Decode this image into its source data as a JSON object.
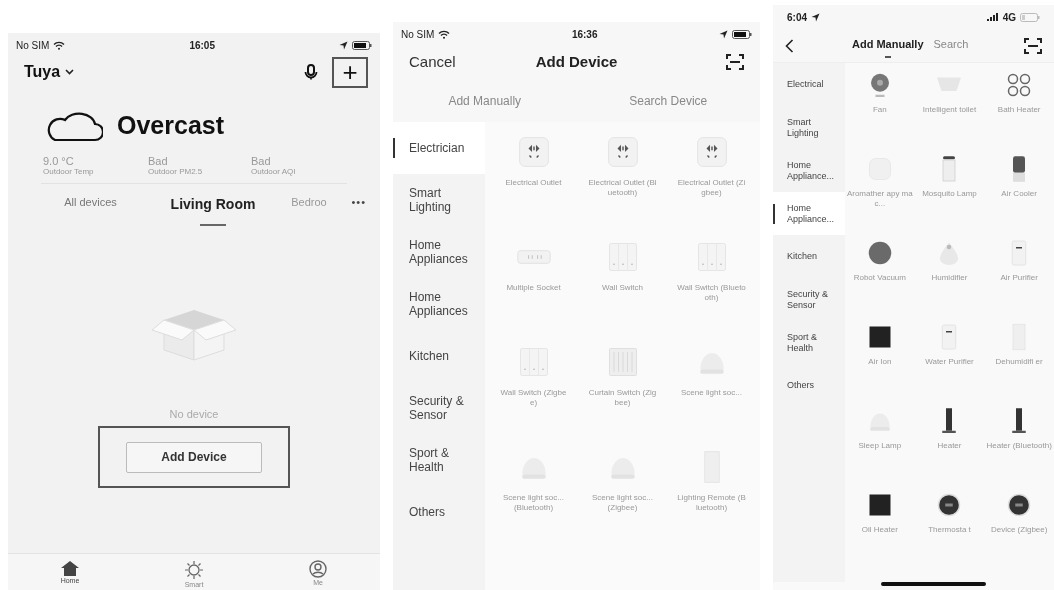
{
  "home_screen": {
    "status_bar": {
      "carrier": "No SIM",
      "time": "16:05"
    },
    "home_name": "Tuya",
    "add_button_icon": "+",
    "weather": {
      "condition": "Overcast",
      "stats": [
        {
          "value": "9.0 °C",
          "label": "Outdoor Temp"
        },
        {
          "value": "Bad",
          "label": "Outdoor PM2.5"
        },
        {
          "value": "Bad",
          "label": "Outdoor AQI"
        }
      ]
    },
    "rooms": [
      {
        "label": "All devices",
        "selected": false
      },
      {
        "label": "Living Room",
        "selected": true
      },
      {
        "label": "Bedroo",
        "selected": false
      }
    ],
    "more": "•••",
    "empty_text": "No device",
    "add_device_button": "Add Device",
    "bottom_tabs": [
      {
        "label": "Home",
        "kind": "home",
        "selected": true
      },
      {
        "label": "Smart",
        "kind": "smart",
        "selected": false
      },
      {
        "label": "Me",
        "kind": "me",
        "selected": false
      }
    ]
  },
  "add_device_screen": {
    "status_bar": {
      "carrier": "No SIM",
      "time": "16:36"
    },
    "cancel": "Cancel",
    "title": "Add Device",
    "tabs": [
      {
        "label": "Add Manually"
      },
      {
        "label": "Search Device"
      }
    ],
    "categories": [
      {
        "label": "Electrician",
        "selected": true
      },
      {
        "label": "Smart Lighting",
        "selected": false
      },
      {
        "label": "Home Appliances",
        "selected": false
      },
      {
        "label": "Home Appliances",
        "selected": false
      },
      {
        "label": "Kitchen",
        "selected": false
      },
      {
        "label": "Security & Sensor",
        "selected": false
      },
      {
        "label": "Sport & Health",
        "selected": false
      },
      {
        "label": "Others",
        "selected": false
      }
    ],
    "devices": [
      {
        "label": "Electrical Outlet",
        "kind": "outlet"
      },
      {
        "label": "Electrical Outlet (Bluetooth)",
        "kind": "outlet"
      },
      {
        "label": "Electrical Outlet (Zigbee)",
        "kind": "outlet"
      },
      {
        "label": "Multiple Socket",
        "kind": "strip"
      },
      {
        "label": "Wall Switch",
        "kind": "switch"
      },
      {
        "label": "Wall Switch (Bluetooth)",
        "kind": "switch"
      },
      {
        "label": "Wall Switch (Zigbee)",
        "kind": "switch"
      },
      {
        "label": "Curtain Switch (Zigbee)",
        "kind": "curtain"
      },
      {
        "label": "Scene light soc...",
        "kind": "dome"
      },
      {
        "label": "Scene light soc... (Bluetooth)",
        "kind": "dome"
      },
      {
        "label": "Scene light soc... (Zigbee)",
        "kind": "dome"
      },
      {
        "label": "Lighting Remote (Bluetooth)",
        "kind": "remote"
      }
    ]
  },
  "add_manually_screen": {
    "status_bar": {
      "time": "6:04",
      "network": "4G"
    },
    "tabs": [
      {
        "label": "Add Manually",
        "selected": true
      },
      {
        "label": "Search",
        "selected": false
      }
    ],
    "categories": [
      {
        "label": "Electrical",
        "selected": false
      },
      {
        "label": "Smart Lighting",
        "selected": false
      },
      {
        "label": "Home Appliance...",
        "selected": false
      },
      {
        "label": "Home Appliance...",
        "selected": true
      },
      {
        "label": "Kitchen",
        "selected": false
      },
      {
        "label": "Security & Sensor",
        "selected": false
      },
      {
        "label": "Sport & Health",
        "selected": false
      },
      {
        "label": "Others",
        "selected": false
      }
    ],
    "devices": [
      {
        "label": "Fan",
        "kind": "fan"
      },
      {
        "label": "Intelligent toilet",
        "kind": "toilet"
      },
      {
        "label": "Bath Heater",
        "kind": "burners"
      },
      {
        "label": "Aromather apy mac...",
        "kind": "diffuser"
      },
      {
        "label": "Mosquito Lamp",
        "kind": "cylinder"
      },
      {
        "label": "Air Cooler",
        "kind": "cooler"
      },
      {
        "label": "Robot Vacuum",
        "kind": "robot"
      },
      {
        "label": "Humidifier",
        "kind": "humidifier"
      },
      {
        "label": "Air Purifier",
        "kind": "purifier"
      },
      {
        "label": "Air Ion",
        "kind": "darkpanel"
      },
      {
        "label": "Water Purifier",
        "kind": "purifier"
      },
      {
        "label": "Dehumidifi er",
        "kind": "remote"
      },
      {
        "label": "Sleep Lamp",
        "kind": "dome"
      },
      {
        "label": "Heater",
        "kind": "tower"
      },
      {
        "label": "Heater (Bluetooth)",
        "kind": "tower"
      },
      {
        "label": "Oil Heater",
        "kind": "darkpanel"
      },
      {
        "label": "Thermosta t",
        "kind": "thermostat"
      },
      {
        "label": "Device (Zigbee)",
        "kind": "thermostat"
      }
    ]
  }
}
